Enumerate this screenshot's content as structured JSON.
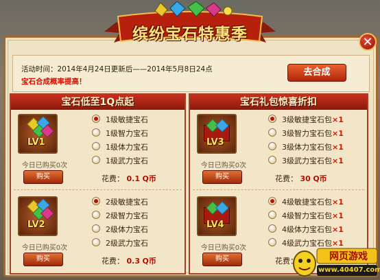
{
  "title": "缤纷宝石特惠季",
  "info": {
    "time_label": "活动时间：",
    "time_value": "2014年4月24日更新后——2014年5月8日24点",
    "notice": "宝石合成概率提高！",
    "merge_button": "去合成"
  },
  "left_panel": {
    "header": "宝石低至1Q点起",
    "tiers": [
      {
        "level": "LV1",
        "bought": "今日已购买0次",
        "buy": "购买",
        "cost_label": "花费：",
        "cost_value": "0.1",
        "cost_unit": "Q币",
        "options": [
          {
            "label": "1级敏捷宝石",
            "selected": true
          },
          {
            "label": "1级智力宝石",
            "selected": false
          },
          {
            "label": "1级体力宝石",
            "selected": false
          },
          {
            "label": "1级武力宝石",
            "selected": false
          }
        ]
      },
      {
        "level": "LV2",
        "bought": "今日已购买0次",
        "buy": "购买",
        "cost_label": "花费：",
        "cost_value": "0.3",
        "cost_unit": "Q币",
        "options": [
          {
            "label": "2级敏捷宝石",
            "selected": true
          },
          {
            "label": "2级智力宝石",
            "selected": false
          },
          {
            "label": "2级体力宝石",
            "selected": false
          },
          {
            "label": "2级武力宝石",
            "selected": false
          }
        ]
      }
    ]
  },
  "right_panel": {
    "header": "宝石礼包惊喜折扣",
    "tiers": [
      {
        "level": "LV3",
        "bought": "今日已购买0次",
        "buy": "购买",
        "cost_label": "花费：",
        "cost_value": "30",
        "cost_unit": "Q币",
        "options": [
          {
            "label": "3级敏捷宝石包",
            "qty": "×1",
            "selected": true
          },
          {
            "label": "3级智力宝石包",
            "qty": "×1",
            "selected": false
          },
          {
            "label": "3级体力宝石包",
            "qty": "×1",
            "selected": false
          },
          {
            "label": "3级武力宝石包",
            "qty": "×1",
            "selected": false
          }
        ]
      },
      {
        "level": "LV4",
        "bought": "今日已购买0次",
        "buy": "购买",
        "cost_label": "花费：",
        "cost_value": "",
        "cost_unit": "",
        "options": [
          {
            "label": "4级敏捷宝石包",
            "qty": "×1",
            "selected": true
          },
          {
            "label": "4级智力宝石包",
            "qty": "×1",
            "selected": false
          },
          {
            "label": "4级体力宝石包",
            "qty": "×1",
            "selected": false
          },
          {
            "label": "4级武力宝石包",
            "qty": "×1",
            "selected": false
          }
        ]
      }
    ]
  },
  "watermark": {
    "line1": "网页游戏",
    "line2": "www.40407.com"
  },
  "colors": {
    "accent_red": "#c8301c",
    "gold": "#ffe27a",
    "parchment": "#f3e5c8"
  },
  "icons": {
    "close": "close-icon",
    "gem_bundle": "gem-bundle-icon",
    "gift_box": "gift-box-icon"
  }
}
